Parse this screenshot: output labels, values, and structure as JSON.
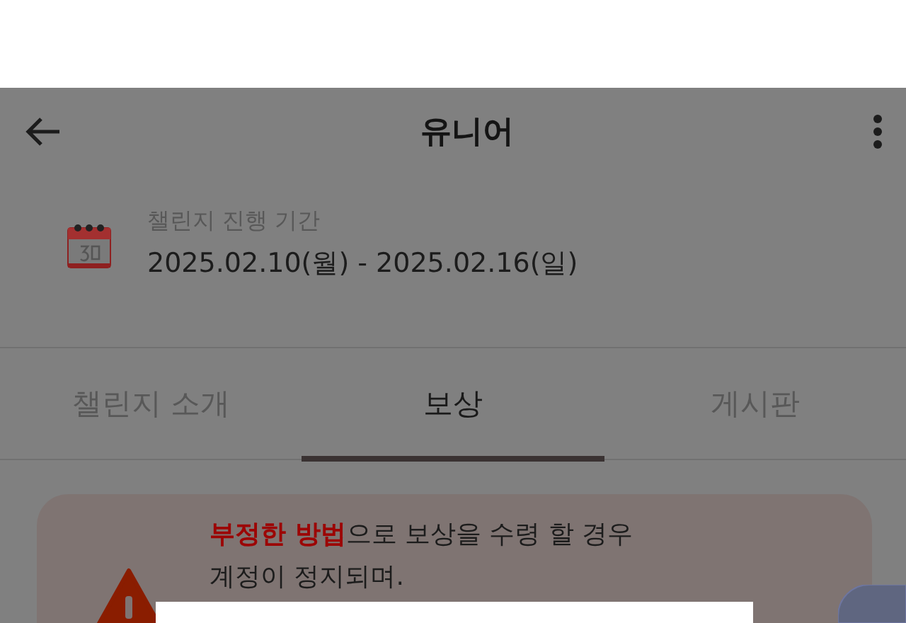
{
  "top_bar": {
    "title": "유니어"
  },
  "challenge_period": {
    "label": "챌린지 진행 기간",
    "dates": "2025.02.10(월) - 2025.02.16(일)"
  },
  "tabs": [
    {
      "label": "챌린지 소개",
      "selected": false
    },
    {
      "label": "보상",
      "selected": true
    },
    {
      "label": "게시판",
      "selected": false
    }
  ],
  "notice": {
    "lines": [
      "**부정한 방법**으로 보상을 수령 할 경우",
      "계정이 정지되며."
    ]
  }
}
